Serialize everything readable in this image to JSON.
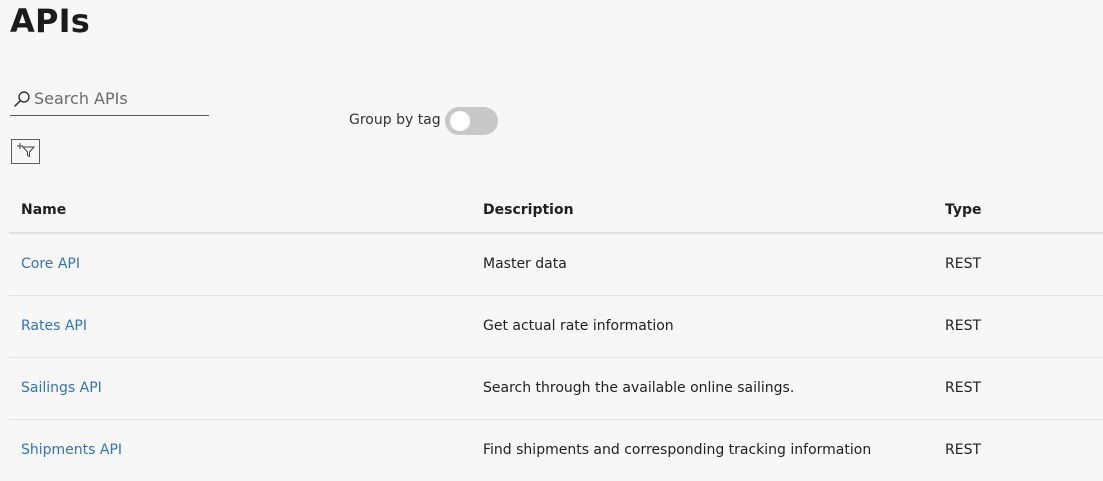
{
  "page": {
    "title": "APIs"
  },
  "search": {
    "placeholder": "Search APIs",
    "value": ""
  },
  "toolbar": {
    "group_by_label": "Group by tag",
    "group_by_enabled": false
  },
  "table": {
    "columns": [
      "Name",
      "Description",
      "Type"
    ],
    "rows": [
      {
        "name": "Core API",
        "description": "Master data",
        "type": "REST"
      },
      {
        "name": "Rates API",
        "description": "Get actual rate information",
        "type": "REST"
      },
      {
        "name": "Sailings API",
        "description": "Search through the available online sailings.",
        "type": "REST"
      },
      {
        "name": "Shipments API",
        "description": "Find shipments and corresponding tracking information",
        "type": "REST"
      }
    ]
  },
  "colors": {
    "link": "#2f73c2",
    "toggle_track": "#c8c8c8",
    "background": "#f7f7f7"
  },
  "icons": {
    "search": "search-icon",
    "filter": "add-filter-icon"
  }
}
